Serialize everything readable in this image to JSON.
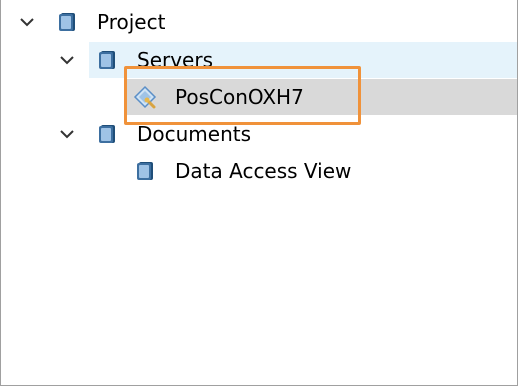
{
  "tree": {
    "project": {
      "label": "Project",
      "expanded": true,
      "icon": "folder-book-icon"
    },
    "servers": {
      "label": "Servers",
      "expanded": true,
      "icon": "folder-book-icon",
      "row_color": "#e5f3fb"
    },
    "server_item": {
      "label": "PosConOXH7",
      "icon": "server-connection-icon",
      "selected": true,
      "selection_color": "#d9d9d9"
    },
    "documents": {
      "label": "Documents",
      "expanded": true,
      "icon": "folder-book-icon"
    },
    "data_access_view": {
      "label": "Data Access View",
      "icon": "folder-book-icon"
    }
  },
  "colors": {
    "highlight_box": "#f0923a",
    "border": "#a0a0a0",
    "icon_blue": "#1f4e79"
  }
}
